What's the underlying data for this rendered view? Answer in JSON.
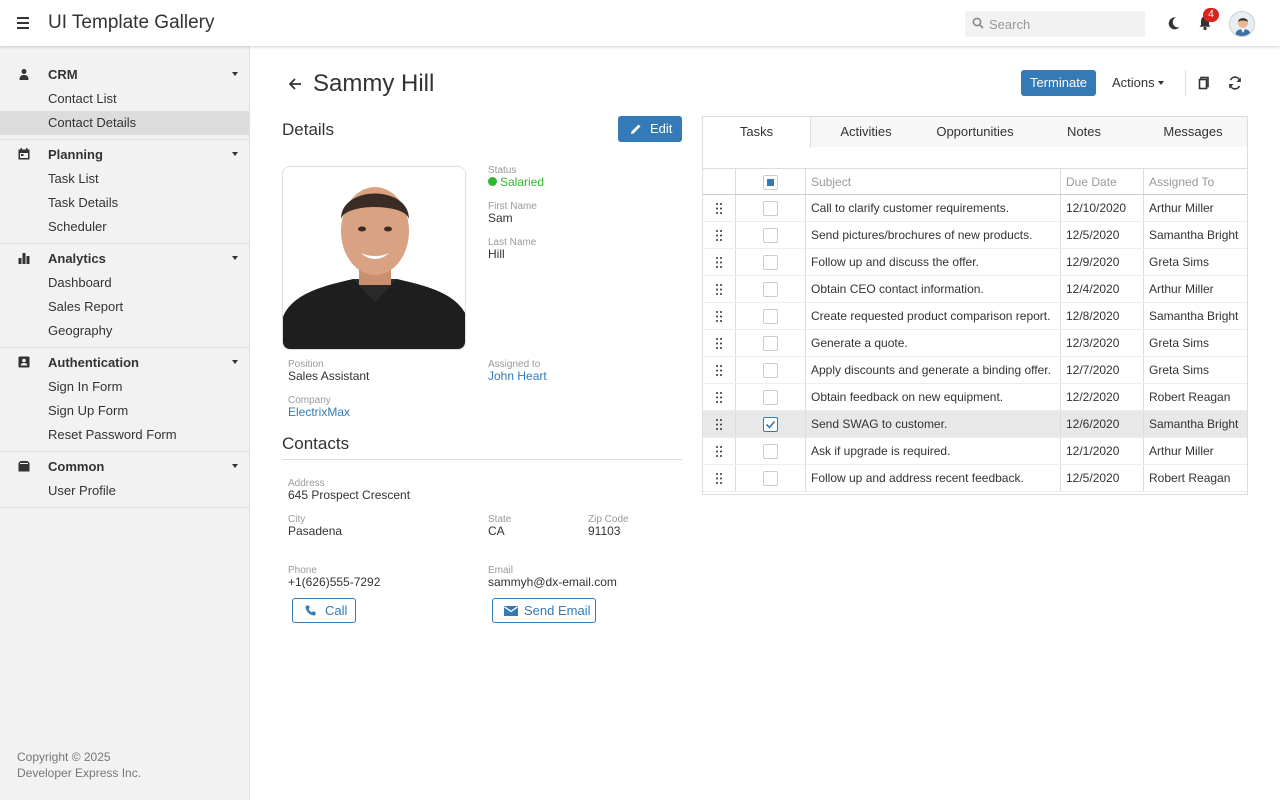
{
  "header": {
    "app_title": "UI Template Gallery",
    "search_placeholder": "Search",
    "notification_count": "4"
  },
  "sidebar": {
    "groups": [
      {
        "label": "CRM",
        "icon": "person-icon",
        "items": [
          "Contact List",
          "Contact Details"
        ]
      },
      {
        "label": "Planning",
        "icon": "calendar-icon",
        "items": [
          "Task List",
          "Task Details",
          "Scheduler"
        ]
      },
      {
        "label": "Analytics",
        "icon": "bar-chart-icon",
        "items": [
          "Dashboard",
          "Sales Report",
          "Geography"
        ]
      },
      {
        "label": "Authentication",
        "icon": "id-card-icon",
        "items": [
          "Sign In Form",
          "Sign Up Form",
          "Reset Password Form"
        ]
      },
      {
        "label": "Common",
        "icon": "folder-icon",
        "items": [
          "User Profile"
        ]
      }
    ],
    "active_item": "Contact Details",
    "copyright_line1": "Copyright © 2025",
    "copyright_line2": "Developer Express Inc."
  },
  "page": {
    "title": "Sammy Hill",
    "terminate_label": "Terminate",
    "actions_label": "Actions"
  },
  "details": {
    "title": "Details",
    "edit_label": "Edit",
    "status_label": "Status",
    "status_value": "Salaried",
    "first_name_label": "First Name",
    "first_name": "Sam",
    "last_name_label": "Last Name",
    "last_name": "Hill",
    "position_label": "Position",
    "position": "Sales Assistant",
    "assigned_to_label": "Assigned to",
    "assigned_to": "John Heart",
    "company_label": "Company",
    "company": "ElectrixMax"
  },
  "contacts": {
    "title": "Contacts",
    "address_label": "Address",
    "address": "645 Prospect Crescent",
    "city_label": "City",
    "city": "Pasadena",
    "state_label": "State",
    "state": "CA",
    "zip_label": "Zip Code",
    "zip": "91103",
    "phone_label": "Phone",
    "phone": "+1(626)555-7292",
    "email_label": "Email",
    "email": "sammyh@dx-email.com",
    "call_label": "Call",
    "send_email_label": "Send Email"
  },
  "tabs": [
    "Tasks",
    "Activities",
    "Opportunities",
    "Notes",
    "Messages"
  ],
  "active_tab": "Tasks",
  "tasks": {
    "columns": {
      "subject": "Subject",
      "due_date": "Due Date",
      "assigned_to": "Assigned To"
    },
    "rows": [
      {
        "subject": "Call to clarify customer requirements.",
        "due": "12/10/2020",
        "assigned": "Arthur Miller",
        "checked": false
      },
      {
        "subject": "Send pictures/brochures of new products.",
        "due": "12/5/2020",
        "assigned": "Samantha Bright",
        "checked": false
      },
      {
        "subject": "Follow up and discuss the offer.",
        "due": "12/9/2020",
        "assigned": "Greta Sims",
        "checked": false
      },
      {
        "subject": "Obtain CEO contact information.",
        "due": "12/4/2020",
        "assigned": "Arthur Miller",
        "checked": false
      },
      {
        "subject": "Create requested product comparison report.",
        "due": "12/8/2020",
        "assigned": "Samantha Bright",
        "checked": false
      },
      {
        "subject": "Generate a quote.",
        "due": "12/3/2020",
        "assigned": "Greta Sims",
        "checked": false
      },
      {
        "subject": "Apply discounts and generate a binding offer.",
        "due": "12/7/2020",
        "assigned": "Greta Sims",
        "checked": false
      },
      {
        "subject": "Obtain feedback on new equipment.",
        "due": "12/2/2020",
        "assigned": "Robert Reagan",
        "checked": false
      },
      {
        "subject": "Send SWAG to customer.",
        "due": "12/6/2020",
        "assigned": "Samantha Bright",
        "checked": true
      },
      {
        "subject": "Ask if upgrade is required.",
        "due": "12/1/2020",
        "assigned": "Arthur Miller",
        "checked": false
      },
      {
        "subject": "Follow up and address recent feedback.",
        "due": "12/5/2020",
        "assigned": "Robert Reagan",
        "checked": false
      }
    ]
  },
  "colors": {
    "accent": "#337ab7",
    "status_green": "#2eb82e",
    "badge_red": "#d9251d"
  }
}
